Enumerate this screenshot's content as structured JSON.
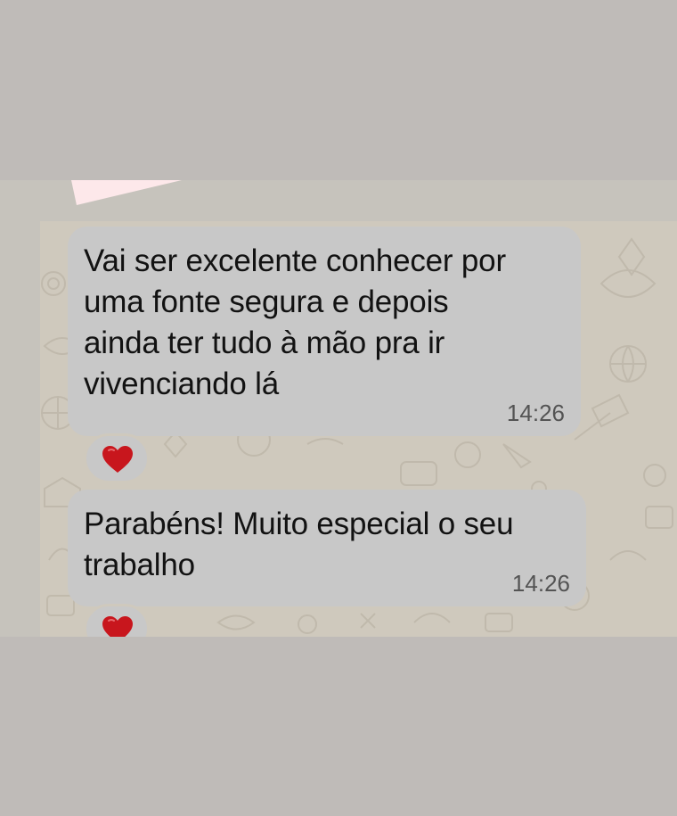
{
  "messages": [
    {
      "text": "Vai ser excelente conhecer por\numa fonte segura e depois\nainda ter tudo à mão pra ir\nvivenciando lá",
      "time": "14:26",
      "reaction": "heart-icon"
    },
    {
      "text": "Parabéns! Muito especial o seu\ntrabalho",
      "time": "14:26",
      "reaction": "heart-icon"
    }
  ],
  "colors": {
    "page_background": "#bfbbb8",
    "chat_background": "#cfc9bd",
    "bubble": "#c8c8c8",
    "heart": "#c8161d",
    "previous_bubble_tail": "#fde8ea"
  }
}
